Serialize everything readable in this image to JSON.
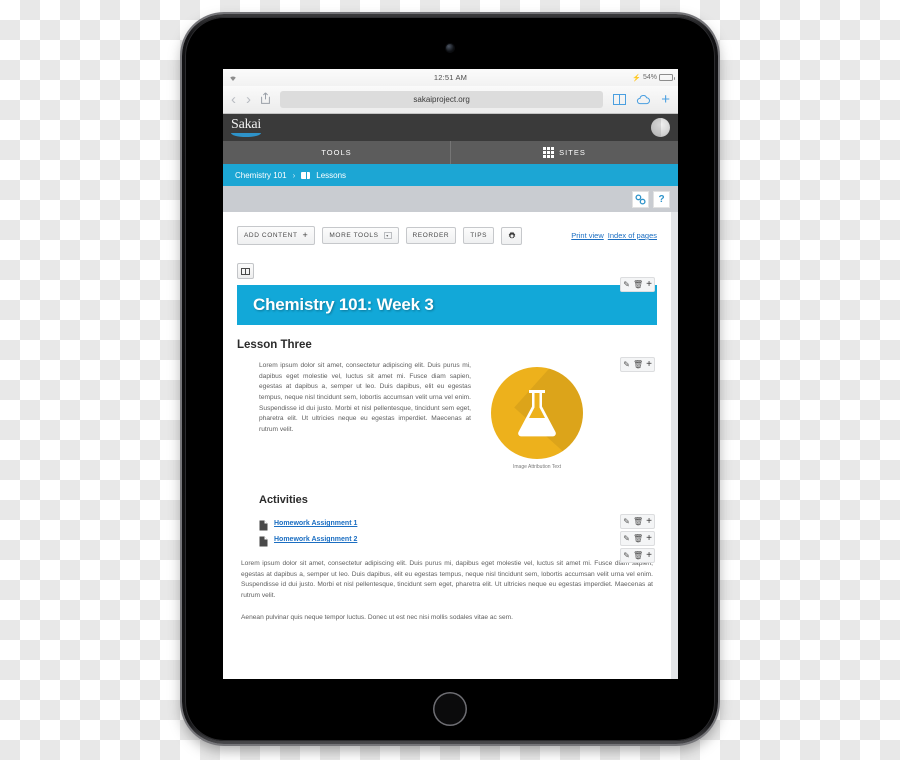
{
  "device": {
    "kind": "tablet-ipad"
  },
  "status_bar": {
    "wifi_icon": "wifi-icon",
    "time": "12:51 AM",
    "bolt_icon": "lightning-bolt-icon",
    "battery_percent": "54%",
    "battery_level": 54
  },
  "safari": {
    "back_label": "‹",
    "forward_label": "›",
    "share_icon": "share-icon",
    "url": "sakaiproject.org",
    "bookmarks_icon": "book-open-icon",
    "cloud_icon": "icloud-tabs-icon",
    "new_tab_label": "+"
  },
  "app_header": {
    "logo_text": "Sakai",
    "avatar_icon": "user-avatar-icon"
  },
  "nav": {
    "tools_label": "TOOLS",
    "sites_label": "SITES",
    "sites_icon": "grid-icon"
  },
  "breadcrumb": {
    "site": "Chemistry 101",
    "separator": "›",
    "tool_icon": "book-icon",
    "tool": "Lessons"
  },
  "action_strip": {
    "link_icon_label": "⚭",
    "help_icon_label": "?"
  },
  "toolbar": {
    "add_content_label": "ADD CONTENT",
    "add_content_plus": "+",
    "more_tools_label": "MORE TOOLS",
    "more_tools_caret": "▾",
    "reorder_label": "REORDER",
    "tips_label": "TIPS",
    "settings_icon": "gear-icon",
    "print_view_label": "Print view",
    "index_of_pages_label": "Index of pages"
  },
  "layout_toggle": {
    "icon": "two-column-layout-icon"
  },
  "item_actions": {
    "edit_icon": "✎",
    "delete_icon": "Ὕ1",
    "add_icon": "+"
  },
  "banner": {
    "title": "Chemistry 101: Week 3",
    "color": "#12a8d8"
  },
  "lesson": {
    "heading": "Lesson Three",
    "intro_paragraph": "Lorem ipsum dolor sit amet, consectetur adipiscing elit. Duis purus mi, dapibus eget molestie vel, luctus sit amet mi. Fusce diam sapien, egestas at dapibus a, semper ut leo. Duis dapibus, elit eu egestas tempus, neque nisl tincidunt sem, lobortis accumsan velit urna vel enim. Suspendisse id dui justo. Morbi et nisl pellentesque, tincidunt sem eget, pharetra elit. Ut ultricies neque eu egestas imperdiet. Maecenas at rutrum velit."
  },
  "figure": {
    "image_icon": "erlenmeyer-flask-icon",
    "circle_color": "#edb11c",
    "attribution": "Image Attribution Text"
  },
  "activities": {
    "heading": "Activities",
    "items": [
      {
        "icon": "document-icon",
        "label": "Homework Assignment 1"
      },
      {
        "icon": "document-icon",
        "label": "Homework Assignment 2"
      }
    ]
  },
  "closing_paragraph": "Lorem ipsum dolor sit amet, consectetur adipiscing elit. Duis purus mi, dapibus eget molestie vel, luctus sit amet mi. Fusce diam sapien, egestas at dapibus a, semper ut leo. Duis dapibus, elit eu egestas tempus, neque nisl tincidunt sem, lobortis accumsan velit urna vel enim. Suspendisse id dui justo. Morbi et nisl pellentesque, tincidunt sem eget, pharetra elit. Ut ultricies neque eu egestas imperdiet. Maecenas at rutrum velit.",
  "cut_paragraph": "Aenean pulvinar quis neque tempor luctus. Donec ut est nec nisi mollis sodales vitae ac sem."
}
